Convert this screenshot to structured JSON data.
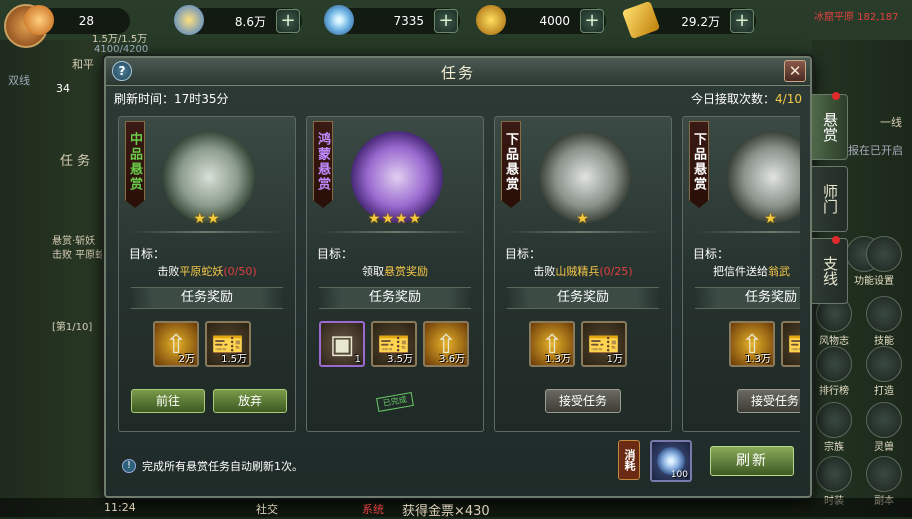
{
  "topbar": {
    "resources": [
      {
        "name": "power",
        "value": "28",
        "color": "#f0a040"
      },
      {
        "name": "gold-ingot",
        "value": "8.6万",
        "color": "#4aa0e0"
      },
      {
        "name": "jade-coin",
        "value": "7335",
        "color": "#8ad0f0"
      },
      {
        "name": "copper-coin",
        "value": "4000",
        "color": "#f0c030"
      },
      {
        "name": "gold-ticket",
        "value": "29.2万",
        "color": "#f0c040"
      }
    ],
    "plus_label": "+"
  },
  "background": {
    "top_left_text": "1.5万/1.5万",
    "hp_text": "4100/4200",
    "level": "34",
    "player_name": "和平",
    "left_labels": [
      "双线",
      "任 务",
      "悬赏·斩妖",
      "击败 平原蛇妖",
      "[第1/10]"
    ],
    "right_top": "冰窟平原 182,187",
    "right_notice": "报在已开启",
    "right_one_line": "一线",
    "right_icons": [
      "功能",
      "设置",
      "风物志",
      "技能",
      "排行榜",
      "打造",
      "宗族",
      "灵兽",
      "时装",
      "副本"
    ],
    "bottom_time": "11:24",
    "bottom_social": "社交",
    "bottom_system": "系统",
    "bottom_message": "获得金票×430"
  },
  "dialog": {
    "title": "任务",
    "help": "?",
    "close": "✕",
    "refresh_time": "刷新时间：17时35分",
    "accept_count_label": "今日接取次数：",
    "accept_count": "4/10",
    "goal_label": "目标：",
    "reward_label": "任务奖励",
    "cards": [
      {
        "grade": "中品悬赏",
        "grade_color": "#6acc4a",
        "stars": "★★",
        "goal_prefix": "击败",
        "goal_target": "平原蛇妖",
        "goal_progress": "(0/50)",
        "rewards": [
          {
            "type": "gold",
            "icon": "⇧",
            "qty": "2万"
          },
          {
            "type": "card-y",
            "icon": "🎫",
            "qty": "1.5万"
          }
        ],
        "buttons": [
          {
            "label": "前往",
            "style": "green"
          },
          {
            "label": "放弃",
            "style": "green"
          }
        ]
      },
      {
        "grade": "鸿蒙悬赏",
        "grade_color": "#c08aff",
        "stars": "★★★★",
        "goal_prefix": "领取",
        "goal_target": "悬赏奖励",
        "goal_progress": "",
        "rewards": [
          {
            "type": "purple",
            "icon": "▣",
            "qty": "1"
          },
          {
            "type": "card-y",
            "icon": "🎫",
            "qty": "3.5万"
          },
          {
            "type": "gold",
            "icon": "⇧",
            "qty": "3.6万"
          }
        ],
        "completed": "已完成"
      },
      {
        "grade": "下品悬赏",
        "grade_color": "#ffffff",
        "stars": "★",
        "goal_prefix": "击败",
        "goal_target": "山贼精兵",
        "goal_progress": "(0/25)",
        "rewards": [
          {
            "type": "gold",
            "icon": "⇧",
            "qty": "1.3万"
          },
          {
            "type": "card-y",
            "icon": "🎫",
            "qty": "1万"
          }
        ],
        "buttons": [
          {
            "label": "接受任务",
            "style": "gray"
          }
        ]
      },
      {
        "grade": "下品悬赏",
        "grade_color": "#ffffff",
        "stars": "★",
        "goal_prefix": "把信件送给",
        "goal_target": "翁武",
        "goal_progress": "",
        "rewards": [
          {
            "type": "gold",
            "icon": "⇧",
            "qty": "1.3万"
          },
          {
            "type": "card-y",
            "icon": "🎫",
            "qty": ""
          }
        ],
        "buttons": [
          {
            "label": "接受任务",
            "style": "gray"
          }
        ]
      }
    ],
    "bottom_info": "完成所有悬赏任务自动刷新1次。",
    "consume_label": "消耗",
    "cost_qty": "100",
    "refresh_button": "刷新"
  },
  "side_tabs": [
    {
      "label": "悬赏",
      "active": true
    },
    {
      "label": "师门",
      "active": false
    },
    {
      "label": "支线",
      "active": false
    }
  ]
}
